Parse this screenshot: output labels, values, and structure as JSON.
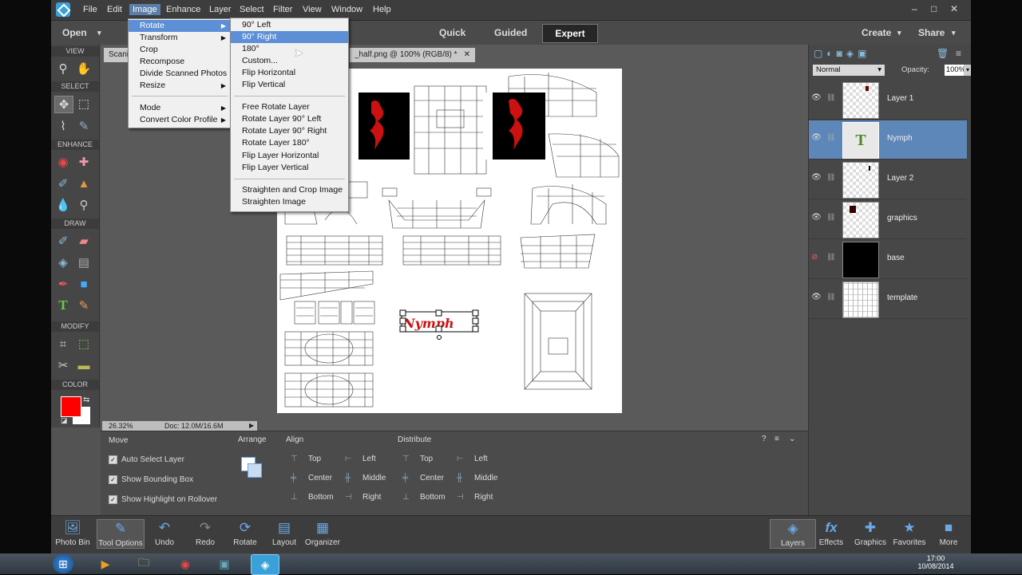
{
  "menubar": {
    "items": [
      "File",
      "Edit",
      "Image",
      "Enhance",
      "Layer",
      "Select",
      "Filter",
      "View",
      "Window",
      "Help"
    ],
    "active": "Image",
    "window_controls": [
      "–",
      "□",
      "✕"
    ]
  },
  "modebar": {
    "open_label": "Open",
    "modes": [
      "Quick",
      "Guided",
      "Expert"
    ],
    "create_label": "Create",
    "share_label": "Share"
  },
  "toolbox": {
    "sections": [
      "VIEW",
      "SELECT",
      "ENHANCE",
      "DRAW",
      "MODIFY",
      "COLOR"
    ],
    "foreground_color": "#ff0000",
    "background_color": "#ffffff"
  },
  "document": {
    "tab_left": "Scani",
    "tab_right": "_half.png @ 100% (RGB/8) *",
    "zoom": "26.32%",
    "doc_info": "Doc: 12.0M/16.6M",
    "text_layer_content": "Nymph"
  },
  "image_menu": {
    "items": [
      "Rotate",
      "Transform",
      "Crop",
      "Recompose",
      "Divide Scanned Photos",
      "Resize",
      "Mode",
      "Convert Color Profile"
    ],
    "highlighted": "Rotate"
  },
  "rotate_submenu": {
    "items": [
      "90° Left",
      "90° Right",
      "180°",
      "Custom...",
      "Flip Horizontal",
      "Flip Vertical",
      "Free Rotate Layer",
      "Rotate Layer 90° Left",
      "Rotate Layer 90° Right",
      "Rotate Layer 180°",
      "Flip Layer Horizontal",
      "Flip Layer Vertical",
      "Straighten and Crop Image",
      "Straighten Image"
    ],
    "highlighted": "90° Right"
  },
  "layers_panel": {
    "blend_mode": "Normal",
    "opacity_label": "Opacity:",
    "opacity_value": "100%",
    "layers": [
      "Layer 1",
      "Nymph",
      "Layer 2",
      "graphics",
      "base",
      "template"
    ],
    "selected": "Nymph"
  },
  "options": {
    "tool_name": "Move",
    "checkboxes": [
      "Auto Select Layer",
      "Show Bounding Box",
      "Show Highlight on Rollover"
    ],
    "arrange_label": "Arrange",
    "align_label": "Align",
    "align_items": [
      "Top",
      "Left",
      "Center",
      "Middle",
      "Bottom",
      "Right"
    ],
    "distribute_label": "Distribute",
    "distribute_items": [
      "Top",
      "Left",
      "Center",
      "Middle",
      "Bottom",
      "Right"
    ]
  },
  "bottombar": {
    "left": [
      "Photo Bin",
      "Tool Options",
      "Undo",
      "Redo",
      "Rotate",
      "Layout",
      "Organizer"
    ],
    "right": [
      "Layers",
      "Effects",
      "Graphics",
      "Favorites",
      "More"
    ]
  },
  "taskbar": {
    "time": "17:00",
    "date": "10/08/2014"
  }
}
